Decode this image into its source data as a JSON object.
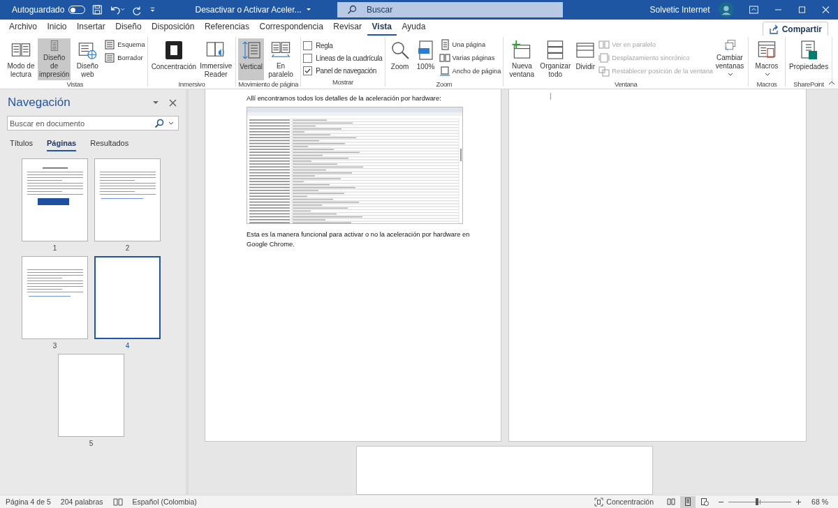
{
  "title_bar": {
    "autosave_label": "Autoguardado",
    "autosave_on": false,
    "document_title": "Desactivar o Activar Aceler...",
    "search_placeholder": "Buscar",
    "user_name": "Solvetic Internet"
  },
  "menu_tabs": [
    {
      "label": "Archivo",
      "selected": false
    },
    {
      "label": "Inicio",
      "selected": false
    },
    {
      "label": "Insertar",
      "selected": false
    },
    {
      "label": "Diseño",
      "selected": false
    },
    {
      "label": "Disposición",
      "selected": false
    },
    {
      "label": "Referencias",
      "selected": false
    },
    {
      "label": "Correspondencia",
      "selected": false
    },
    {
      "label": "Revisar",
      "selected": false
    },
    {
      "label": "Vista",
      "selected": true
    },
    {
      "label": "Ayuda",
      "selected": false
    }
  ],
  "share_button": "Compartir",
  "ribbon_groups": [
    {
      "label": "Vistas",
      "columns": [
        {
          "kind": "large",
          "label": "Modo de lectura",
          "selected": false
        },
        {
          "kind": "large",
          "label": "Diseño de impresión",
          "selected": true
        },
        {
          "kind": "large",
          "label": "Diseño web",
          "selected": false
        },
        {
          "kind": "small",
          "items": [
            {
              "label": "Esquema",
              "disabled": false
            },
            {
              "label": "Borrador",
              "disabled": false
            }
          ]
        }
      ]
    },
    {
      "label": "Inmersivo",
      "columns": [
        {
          "kind": "large",
          "label": "Concentración"
        },
        {
          "kind": "large",
          "label": "Immersive Reader"
        }
      ]
    },
    {
      "label": "Movimiento de página",
      "columns": [
        {
          "kind": "large",
          "label": "Vertical",
          "selected": true
        },
        {
          "kind": "large",
          "label": "En paralelo",
          "selected": false
        }
      ]
    },
    {
      "label": "Mostrar",
      "columns": [
        {
          "kind": "checks",
          "items": [
            {
              "label": "Regla",
              "checked": false
            },
            {
              "label": "Líneas de la cuadrícula",
              "checked": false
            },
            {
              "label": "Panel de navegación",
              "checked": true
            }
          ]
        }
      ]
    },
    {
      "label": "Zoom",
      "columns": [
        {
          "kind": "large",
          "label": "Zoom"
        },
        {
          "kind": "large",
          "label": "100%"
        },
        {
          "kind": "small",
          "items": [
            {
              "label": "Una página",
              "disabled": false
            },
            {
              "label": "Varias páginas",
              "disabled": false
            },
            {
              "label": "Ancho de página",
              "disabled": false
            }
          ]
        }
      ]
    },
    {
      "label": "Ventana",
      "columns": [
        {
          "kind": "large",
          "label": "Nueva ventana"
        },
        {
          "kind": "large",
          "label": "Organizar todo"
        },
        {
          "kind": "large",
          "label": "Dividir"
        },
        {
          "kind": "small",
          "items": [
            {
              "label": "Ver en paralelo",
              "disabled": true
            },
            {
              "label": "Desplazamiento sincrónico",
              "disabled": true
            },
            {
              "label": "Restablecer posición de la ventana",
              "disabled": true
            }
          ]
        },
        {
          "kind": "large",
          "label": "Cambiar ventanas",
          "dropdown": true
        }
      ]
    },
    {
      "label": "Macros",
      "columns": [
        {
          "kind": "large",
          "label": "Macros",
          "dropdown": true
        }
      ]
    },
    {
      "label": "SharePoint",
      "columns": [
        {
          "kind": "large",
          "label": "Propiedades"
        }
      ]
    }
  ],
  "navigation": {
    "title": "Navegación",
    "search_placeholder": "Buscar en documento",
    "tabs": [
      {
        "label": "Títulos",
        "selected": false
      },
      {
        "label": "Páginas",
        "selected": true
      },
      {
        "label": "Resultados",
        "selected": false
      }
    ],
    "pages": [
      {
        "label": "1",
        "kind": "content",
        "selected": false
      },
      {
        "label": "2",
        "kind": "content",
        "selected": false
      },
      {
        "label": "3",
        "kind": "content",
        "selected": false
      },
      {
        "label": "4",
        "kind": "blank",
        "selected": true
      },
      {
        "label": "5",
        "kind": "blank",
        "selected": false
      }
    ]
  },
  "document": {
    "paragraphs": [
      "Allí encontramos todos los detalles de la aceleración por hardware:",
      "Esta es la manera funcional para activar o no la aceleración por hardware en Google Chrome."
    ]
  },
  "status_bar": {
    "page": "Página 4 de 5",
    "words": "204 palabras",
    "language": "Español (Colombia)",
    "focus": "Concentración",
    "view_buttons": [
      {
        "selected": false
      },
      {
        "selected": true
      },
      {
        "selected": false
      }
    ],
    "zoom": {
      "level": 0.45,
      "reading": "68 %"
    }
  }
}
